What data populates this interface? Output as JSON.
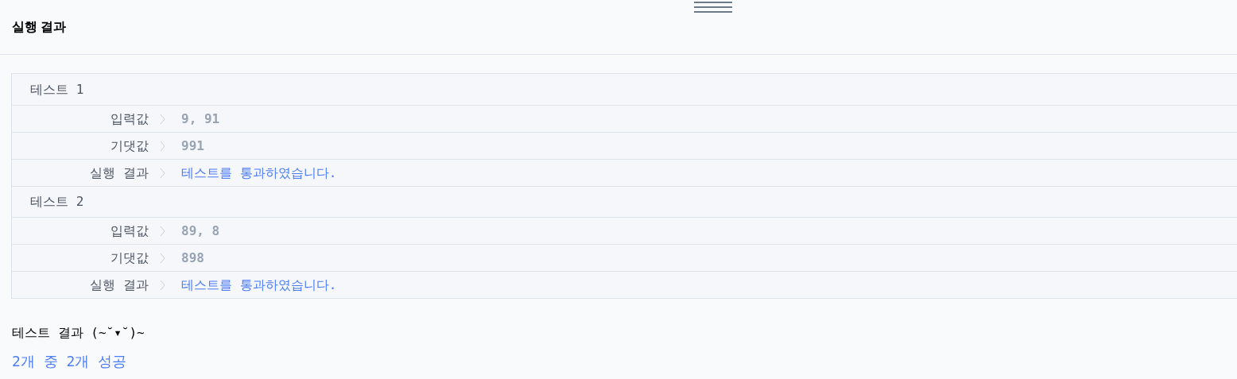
{
  "panel": {
    "title": "실행 결과"
  },
  "tests": [
    {
      "title": "테스트 1",
      "rows": [
        {
          "label": "입력값",
          "value": "9, 91",
          "kind": "value"
        },
        {
          "label": "기댓값",
          "value": "991",
          "kind": "value"
        },
        {
          "label": "실행 결과",
          "value": "테스트를 통과하였습니다.",
          "kind": "result"
        }
      ]
    },
    {
      "title": "테스트 2",
      "rows": [
        {
          "label": "입력값",
          "value": "89, 8",
          "kind": "value"
        },
        {
          "label": "기댓값",
          "value": "898",
          "kind": "value"
        },
        {
          "label": "실행 결과",
          "value": "테스트를 통과하였습니다.",
          "kind": "result"
        }
      ]
    }
  ],
  "summary": {
    "heading": "테스트 결과 (~˘▾˘)~",
    "result": "2개 중 2개 성공"
  }
}
